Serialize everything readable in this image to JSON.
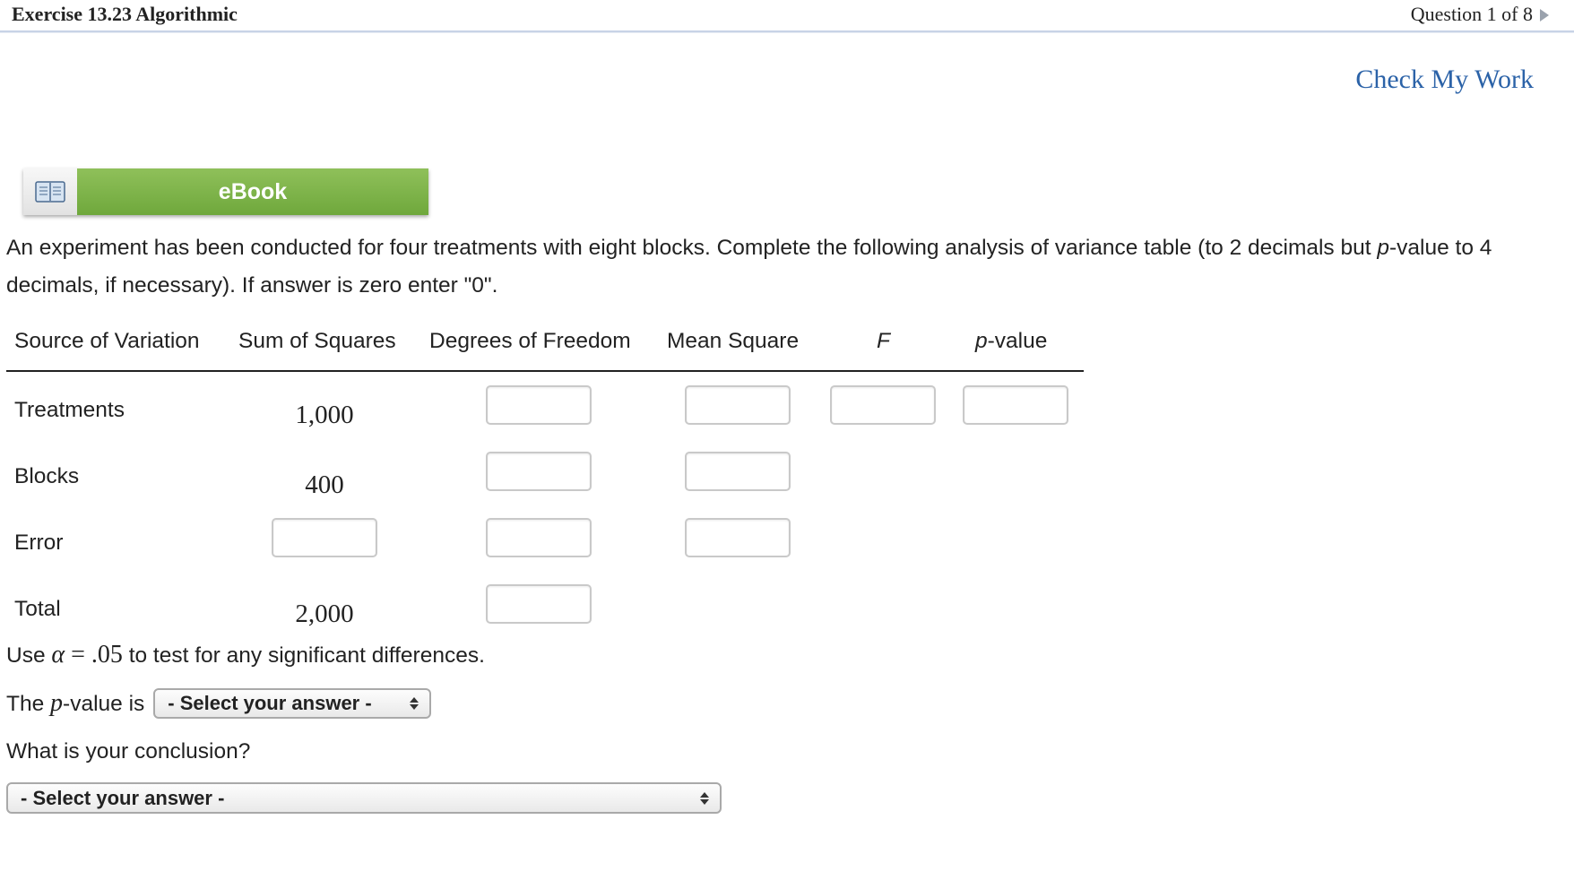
{
  "header": {
    "exercise_title": "Exercise 13.23 Algorithmic",
    "question_nav": "Question 1 of 8"
  },
  "check_my_work": "Check My Work",
  "ebook": {
    "label": "eBook"
  },
  "problem": {
    "part1": "An experiment has been conducted for four treatments with eight blocks. Complete the following analysis of variance table (to 2 decimals but ",
    "pvalue_word": "p",
    "part2": "-value to 4 decimals, if necessary). If answer is zero enter \"0\"."
  },
  "table": {
    "headers": {
      "source": "Source of Variation",
      "ss": "Sum of Squares",
      "df": "Degrees of Freedom",
      "ms": "Mean Square",
      "f": "F",
      "pvalue_p": "p",
      "pvalue_rest": "-value"
    },
    "rows": {
      "treatments": {
        "label": "Treatments",
        "ss": "1,000"
      },
      "blocks": {
        "label": "Blocks",
        "ss": "400"
      },
      "error": {
        "label": "Error"
      },
      "total": {
        "label": "Total",
        "ss": "2,000"
      }
    }
  },
  "alpha_line": {
    "use": "Use ",
    "alpha": "α",
    "eq": " = ",
    "value": ".05",
    "rest": " to test for any significant differences."
  },
  "pvalue_question": {
    "prefix": "The ",
    "p": "p",
    "suffix": "-value is",
    "select_value": "- Select your answer -"
  },
  "conclusion": {
    "label": "What is your conclusion?",
    "select_value": "- Select your answer -"
  }
}
